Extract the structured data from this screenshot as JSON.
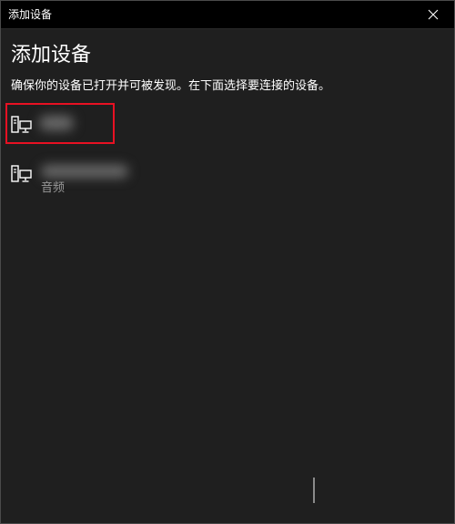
{
  "window": {
    "title": "添加设备"
  },
  "main": {
    "title": "添加设备",
    "instructions": "确保你的设备已打开并可被发现。在下面选择要连接的设备。"
  },
  "devices": [
    {
      "icon": "computer-icon",
      "type": ""
    },
    {
      "icon": "computer-icon",
      "type": "音频"
    }
  ],
  "colors": {
    "background": "#1f1f1f",
    "titlebar": "#000000",
    "highlight": "#e81123",
    "secondary_text": "#9a9a9a"
  }
}
